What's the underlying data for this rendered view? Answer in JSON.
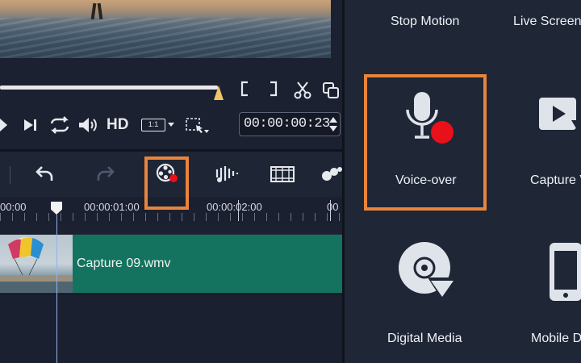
{
  "preview": {
    "timecode": "00:00:00:23"
  },
  "player_controls": {
    "hd_label": "HD",
    "ratio_label": "1:1"
  },
  "timeline": {
    "ruler_labels": [
      "00:00",
      "00:00:01:00",
      "00:00:02:00",
      "00"
    ],
    "clip_name": "Capture 09.wmv"
  },
  "capture_panel": {
    "items": [
      {
        "label": "Stop Motion",
        "icon": "stop-motion-icon"
      },
      {
        "label": "Live Screen",
        "icon": "live-screen-icon"
      },
      {
        "label": "Voice-over",
        "icon": "microphone-record-icon",
        "highlighted": true
      },
      {
        "label": "Capture V",
        "icon": "capture-video-icon"
      },
      {
        "label": "Digital Media",
        "icon": "disc-import-icon"
      },
      {
        "label": "Mobile D",
        "icon": "mobile-device-icon"
      }
    ]
  },
  "colors": {
    "highlight": "#e8853b",
    "record_dot": "#e8101a",
    "clip": "#14735e",
    "panel_bg": "#1f2636"
  }
}
